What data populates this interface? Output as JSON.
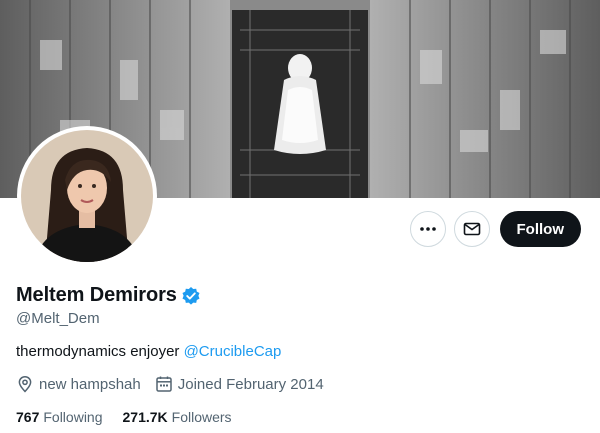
{
  "banner": {
    "icon": "banner-image"
  },
  "avatar": {
    "icon": "profile-photo"
  },
  "actions": {
    "more_icon": "more-icon",
    "message_icon": "mail-icon",
    "follow_label": "Follow"
  },
  "profile": {
    "name": "Meltem Demirors",
    "verified": true,
    "handle": "@Melt_Dem",
    "bio_text": "thermodynamics enjoyer ",
    "bio_mention": "@CrucibleCap",
    "location": "new hampshah",
    "joined": "Joined February 2014"
  },
  "stats": {
    "following_count": "767",
    "following_label": "Following",
    "followers_count": "271.7K",
    "followers_label": "Followers"
  },
  "colors": {
    "accent": "#1d9bf0",
    "text_primary": "#0f1419",
    "text_secondary": "#536471",
    "follow_bg": "#0f1419"
  }
}
